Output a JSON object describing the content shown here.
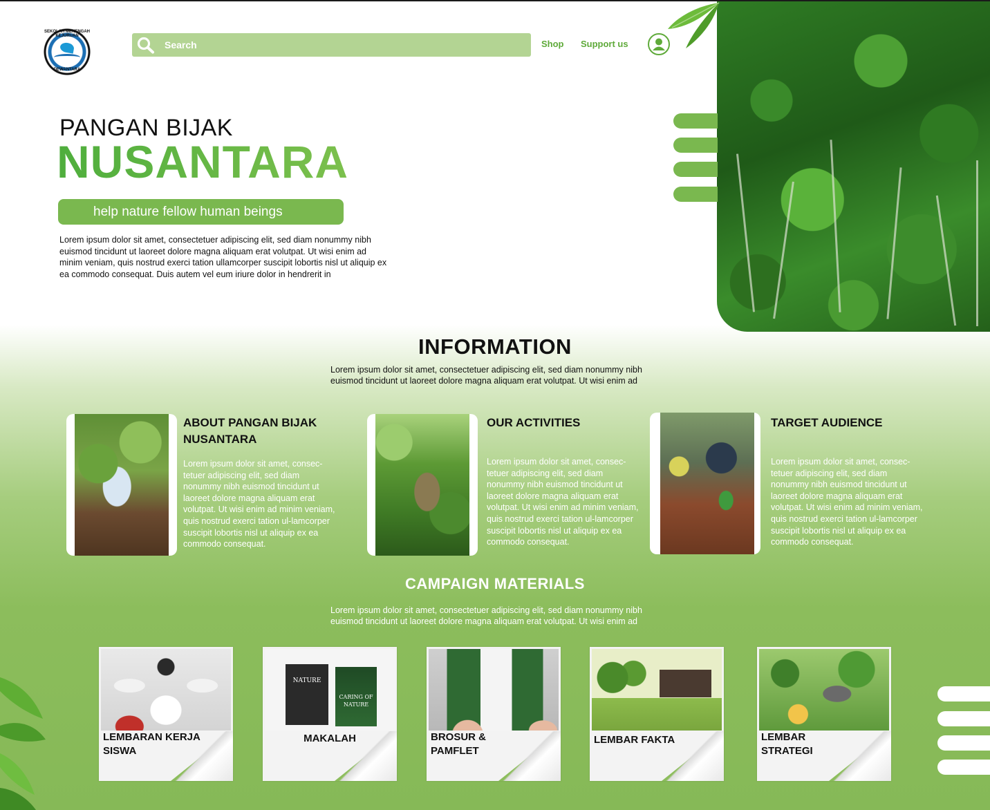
{
  "header": {
    "logo_top_text": "SEKOLAH MENENGAH KEJURUAN",
    "logo_bottom_text": "DEWANTARA",
    "search_placeholder": "Search",
    "nav": [
      {
        "label": "Shop"
      },
      {
        "label": "Support us"
      }
    ]
  },
  "hero": {
    "title_small": "PANGAN BIJAK",
    "title_big": "NUSANTARA",
    "tagline": "help nature fellow human beings",
    "paragraph": "Lorem ipsum dolor sit amet, consectetuer adipiscing elit, sed diam nonummy nibh euismod tincidunt ut laoreet dolore magna aliquam erat volutpat. Ut wisi enim ad minim veniam, quis nostrud exerci tation ullamcorper suscipit lobortis nisl ut aliquip ex ea commodo consequat. Duis autem vel eum iriure dolor in hendrerit in"
  },
  "information": {
    "title": "INFORMATION",
    "paragraph": "Lorem ipsum dolor sit amet, consectetuer adipiscing elit, sed diam nonummy nibh euismod tincidunt ut laoreet dolore magna aliquam erat volutpat. Ut wisi enim ad",
    "cards": [
      {
        "title": "ABOUT PANGAN BIJAK NUSANTARA",
        "text": "Lorem ipsum dolor sit amet, consec-tetuer adipiscing elit, sed diam nonummy nibh euismod tincidunt ut laoreet dolore magna aliquam erat volutpat. Ut wisi enim ad minim veniam, quis nostrud exerci tation ul-lamcorper suscipit lobortis nisl ut aliquip ex ea commodo consequat."
      },
      {
        "title": "OUR ACTIVITIES",
        "text": "Lorem ipsum dolor sit amet, consec-tetuer adipiscing elit, sed diam nonummy nibh euismod tincidunt ut laoreet dolore magna aliquam erat volutpat. Ut wisi enim ad minim veniam, quis nostrud exerci tation ul-lamcorper suscipit lobortis nisl ut aliquip ex ea commodo consequat."
      },
      {
        "title": "TARGET AUDIENCE",
        "text": "Lorem ipsum dolor sit amet, consec-tetuer adipiscing elit, sed diam nonummy nibh euismod tincidunt ut laoreet dolore magna aliquam erat volutpat. Ut wisi enim ad minim veniam, quis nostrud exerci tation ul-lamcorper suscipit lobortis nisl ut aliquip ex ea commodo consequat."
      }
    ]
  },
  "campaign": {
    "title": "CAMPAIGN MATERIALS",
    "paragraph": "Lorem ipsum dolor sit amet, consectetuer adipiscing elit, sed diam nonummy nibh euismod tincidunt ut laoreet dolore magna aliquam erat volutpat. Ut wisi enim ad",
    "materials": [
      {
        "label": "LEMBARAN KERJA SISWA"
      },
      {
        "label": "MAKALAH"
      },
      {
        "label": "BROSUR & PAMFLET"
      },
      {
        "label": "LEMBAR FAKTA"
      },
      {
        "label": "LEMBAR STRATEGI"
      }
    ],
    "poster_texts": {
      "makalah_left": "NATURE",
      "makalah_right": "CARING OF NATURE"
    }
  },
  "colors": {
    "accent_green": "#7ab84f",
    "nav_green": "#5faa3a",
    "search_bg": "#b3d493",
    "section_bg": "#8cbd5c"
  },
  "icons": [
    "search-icon",
    "user-icon",
    "leaf-icon"
  ]
}
